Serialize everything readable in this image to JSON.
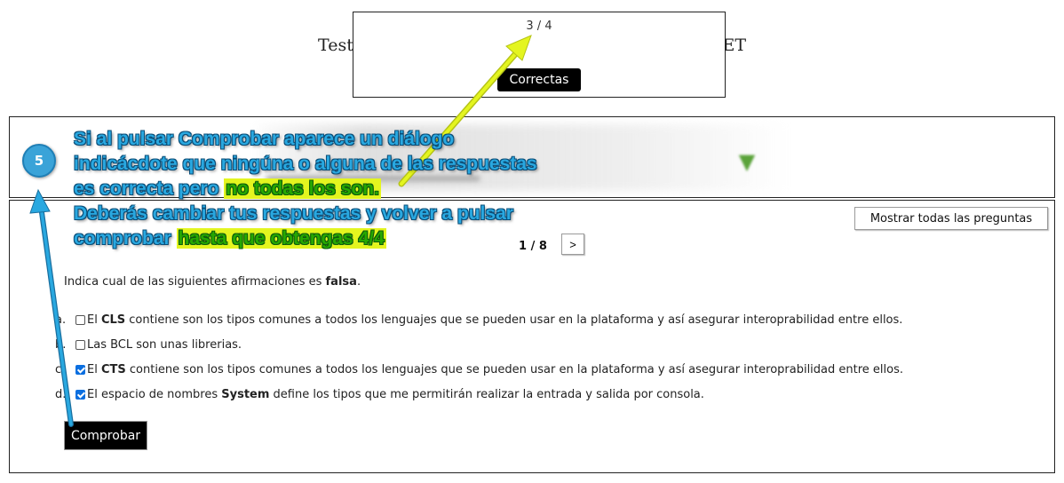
{
  "header": {
    "title_start": "Test",
    "title_end": "ET"
  },
  "dialog": {
    "score": "3 / 4",
    "ok_label": "Correctas"
  },
  "toolbar": {
    "show_all_label": "Mostrar todas las preguntas",
    "pager": "1 / 8",
    "next_label": ">"
  },
  "question": {
    "text_start": "Indica cual de las siguientes afirmaciones es ",
    "text_bold": "falsa",
    "text_end": ".",
    "options": [
      {
        "letter": "a.",
        "checked": false,
        "pre": "El ",
        "bold": "CLS",
        "post": " contiene son los tipos comunes a todos los lenguajes que se pueden usar en la plataforma y así asegurar interoprabilidad entre ellos."
      },
      {
        "letter": "b.",
        "checked": false,
        "pre": "Las BCL son unas librerias.",
        "bold": "",
        "post": ""
      },
      {
        "letter": "c.",
        "checked": true,
        "pre": "El ",
        "bold": "CTS",
        "post": " contiene son los tipos comunes a todos los lenguajes que se pueden usar en la plataforma y así asegurar interoprabilidad entre ellos."
      },
      {
        "letter": "d.",
        "checked": true,
        "pre": "El espacio de nombres ",
        "bold": "System",
        "post": " define los tipos que me permitirán realizar la entrada y salida por consola."
      }
    ]
  },
  "actions": {
    "check_label": "Comprobar"
  },
  "annotation": {
    "step": "5",
    "line1": "Si al pulsar Comprobar aparece un diálogo",
    "line2": "indicácdote que ningúna o alguna de las respuestas",
    "line3_pre": "es correcta pero ",
    "line3_hl": "no todas los son.",
    "line4": "Deberás cambiar tus respuestas y volver a pulsar",
    "line5_pre": "comprobar ",
    "line5_hl": "hasta que obtengas 4/4",
    "colors": {
      "tip": "#29a8e0",
      "highlight": "#e4f51f",
      "arrow_yellow": "#e4f51f",
      "arrow_blue": "#29a8e0"
    }
  }
}
